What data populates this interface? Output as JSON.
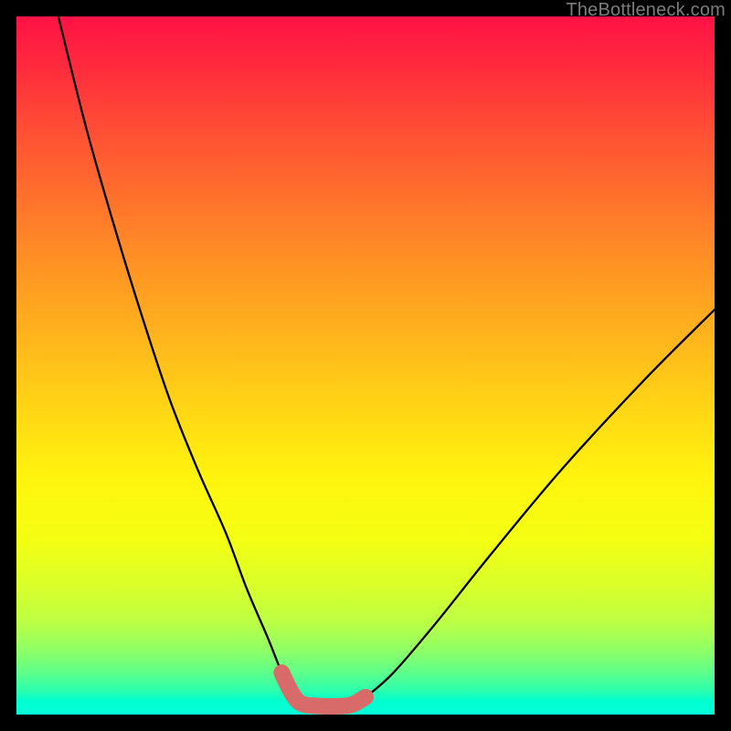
{
  "watermark": "TheBottleneck.com",
  "chart_data": {
    "type": "line",
    "title": "",
    "xlabel": "",
    "ylabel": "",
    "xlim": [
      0,
      100
    ],
    "ylim": [
      0,
      100
    ],
    "series": [
      {
        "name": "bottleneck-curve",
        "x": [
          6,
          10,
          14,
          18,
          22,
          26,
          30,
          33,
          36,
          38,
          39.5,
          41,
          44,
          46,
          48,
          50,
          54,
          60,
          68,
          78,
          90,
          100
        ],
        "y": [
          100,
          84,
          70,
          57,
          45,
          35,
          26,
          18,
          11,
          6,
          3,
          1.5,
          1.2,
          1.2,
          1.4,
          2.5,
          6,
          13,
          23,
          35,
          48,
          58
        ]
      }
    ],
    "highlight": {
      "name": "optimal-range",
      "x": [
        38,
        39.5,
        41,
        44,
        46,
        48,
        50
      ],
      "y": [
        6,
        3,
        1.5,
        1.2,
        1.2,
        1.4,
        2.5
      ],
      "color": "#d86a6a"
    },
    "gradient_stops": [
      {
        "pos": 0.0,
        "color": "#ff1245"
      },
      {
        "pos": 0.33,
        "color": "#ff8a26"
      },
      {
        "pos": 0.66,
        "color": "#fff40e"
      },
      {
        "pos": 0.95,
        "color": "#2effac"
      },
      {
        "pos": 1.0,
        "color": "#00ffd8"
      }
    ]
  }
}
